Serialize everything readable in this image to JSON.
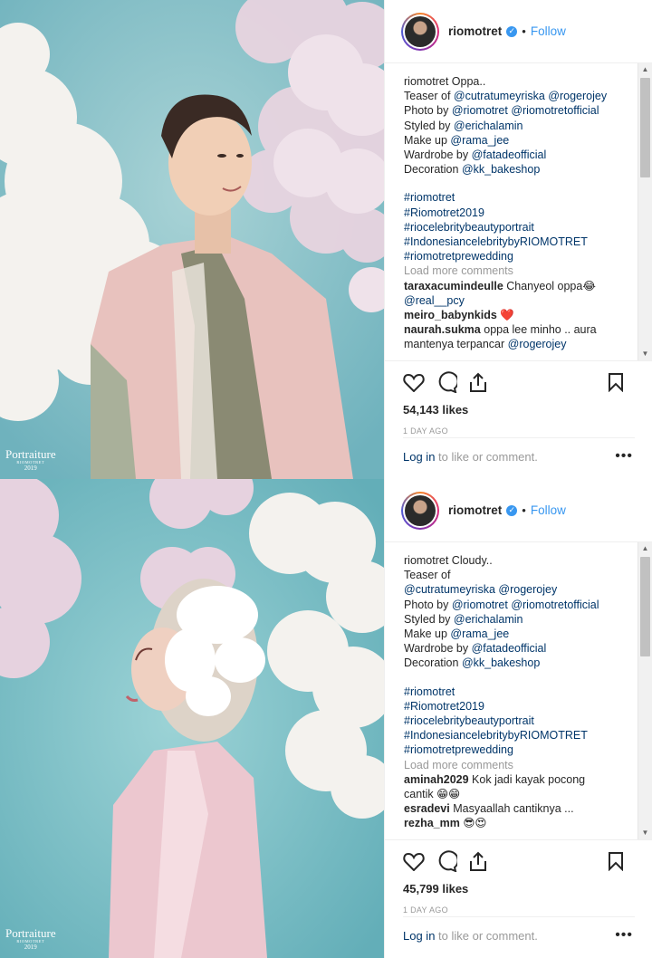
{
  "posts": [
    {
      "username": "riomotret",
      "follow_label": "Follow",
      "caption_lines": [
        {
          "parts": [
            {
              "t": "riomotret ",
              "c": "plain"
            },
            {
              "t": "Oppa..",
              "c": "plain"
            }
          ]
        },
        {
          "parts": [
            {
              "t": "Teaser of ",
              "c": "plain"
            },
            {
              "t": "@cutratumeyriska",
              "c": "link"
            },
            {
              "t": " ",
              "c": "plain"
            },
            {
              "t": "@rogerojey",
              "c": "link"
            }
          ]
        },
        {
          "parts": [
            {
              "t": "Photo by ",
              "c": "plain"
            },
            {
              "t": "@riomotret",
              "c": "link"
            },
            {
              "t": " ",
              "c": "plain"
            },
            {
              "t": "@riomotretofficial",
              "c": "link"
            }
          ]
        },
        {
          "parts": [
            {
              "t": "Styled by ",
              "c": "plain"
            },
            {
              "t": "@erichalamin",
              "c": "link"
            }
          ]
        },
        {
          "parts": [
            {
              "t": "Make up ",
              "c": "plain"
            },
            {
              "t": "@rama_jee",
              "c": "link"
            }
          ]
        },
        {
          "parts": [
            {
              "t": "Wardrobe by ",
              "c": "plain"
            },
            {
              "t": "@fatadeofficial",
              "c": "link"
            }
          ]
        },
        {
          "parts": [
            {
              "t": "Decoration ",
              "c": "plain"
            },
            {
              "t": "@kk_bakeshop",
              "c": "link"
            }
          ]
        },
        {
          "gap": true
        },
        {
          "parts": [
            {
              "t": "#riomotret",
              "c": "link"
            }
          ]
        },
        {
          "parts": [
            {
              "t": "#Riomotret2019",
              "c": "link"
            }
          ]
        },
        {
          "parts": [
            {
              "t": "#riocelebritybeautyportrait",
              "c": "link"
            }
          ]
        },
        {
          "parts": [
            {
              "t": "#IndonesiancelebritybyRIOMOTRET",
              "c": "link"
            }
          ]
        },
        {
          "parts": [
            {
              "t": "#riomotretprewedding",
              "c": "link"
            }
          ]
        },
        {
          "parts": [
            {
              "t": "Load more comments",
              "c": "muted"
            }
          ]
        },
        {
          "parts": [
            {
              "t": "taraxacumindeulle",
              "c": "bold"
            },
            {
              "t": " Chanyeol oppa😂",
              "c": "plain"
            }
          ]
        },
        {
          "parts": [
            {
              "t": "@real__pcy",
              "c": "link"
            }
          ]
        },
        {
          "parts": [
            {
              "t": "meiro_babynkids",
              "c": "bold"
            },
            {
              "t": " ❤️",
              "c": "plain"
            }
          ]
        },
        {
          "parts": [
            {
              "t": "naurah.sukma",
              "c": "bold"
            },
            {
              "t": " oppa lee minho .. aura",
              "c": "plain"
            }
          ]
        },
        {
          "parts": [
            {
              "t": "mantenya terpancar ",
              "c": "plain"
            },
            {
              "t": "@rogerojey",
              "c": "link"
            }
          ]
        }
      ],
      "likes": "54,143 likes",
      "time_ago": "1 DAY AGO",
      "login_link": "Log in",
      "login_rest": " to like or comment.",
      "watermark": {
        "title": "Portraiture",
        "sub": "RIOMOTRET",
        "year": "2019"
      }
    },
    {
      "username": "riomotret",
      "follow_label": "Follow",
      "caption_lines": [
        {
          "parts": [
            {
              "t": "riomotret ",
              "c": "plain"
            },
            {
              "t": "Cloudy..",
              "c": "plain"
            }
          ]
        },
        {
          "parts": [
            {
              "t": "Teaser of",
              "c": "plain"
            }
          ]
        },
        {
          "parts": [
            {
              "t": "@cutratumeyriska",
              "c": "link"
            },
            {
              "t": " ",
              "c": "plain"
            },
            {
              "t": "@rogerojey",
              "c": "link"
            }
          ]
        },
        {
          "parts": [
            {
              "t": "Photo by ",
              "c": "plain"
            },
            {
              "t": "@riomotret",
              "c": "link"
            },
            {
              "t": " ",
              "c": "plain"
            },
            {
              "t": "@riomotretofficial",
              "c": "link"
            }
          ]
        },
        {
          "parts": [
            {
              "t": "Styled by ",
              "c": "plain"
            },
            {
              "t": "@erichalamin",
              "c": "link"
            }
          ]
        },
        {
          "parts": [
            {
              "t": "Make up ",
              "c": "plain"
            },
            {
              "t": "@rama_jee",
              "c": "link"
            }
          ]
        },
        {
          "parts": [
            {
              "t": "Wardrobe by ",
              "c": "plain"
            },
            {
              "t": "@fatadeofficial",
              "c": "link"
            }
          ]
        },
        {
          "parts": [
            {
              "t": "Decoration ",
              "c": "plain"
            },
            {
              "t": "@kk_bakeshop",
              "c": "link"
            }
          ]
        },
        {
          "gap": true
        },
        {
          "parts": [
            {
              "t": "#riomotret",
              "c": "link"
            }
          ]
        },
        {
          "parts": [
            {
              "t": "#Riomotret2019",
              "c": "link"
            }
          ]
        },
        {
          "parts": [
            {
              "t": "#riocelebritybeautyportrait",
              "c": "link"
            }
          ]
        },
        {
          "parts": [
            {
              "t": "#IndonesiancelebritybyRIOMOTRET",
              "c": "link"
            }
          ]
        },
        {
          "parts": [
            {
              "t": "#riomotretprewedding",
              "c": "link"
            }
          ]
        },
        {
          "parts": [
            {
              "t": "Load more comments",
              "c": "muted"
            }
          ]
        },
        {
          "parts": [
            {
              "t": "aminah2029",
              "c": "bold"
            },
            {
              "t": " Kok jadi kayak pocong",
              "c": "plain"
            }
          ]
        },
        {
          "parts": [
            {
              "t": "cantik 😁😁",
              "c": "plain"
            }
          ]
        },
        {
          "parts": [
            {
              "t": "esradevi",
              "c": "bold"
            },
            {
              "t": " Masyaallah cantiknya ...",
              "c": "plain"
            }
          ]
        },
        {
          "parts": [
            {
              "t": "rezha_mm",
              "c": "bold"
            },
            {
              "t": " 😎😍",
              "c": "plain"
            }
          ]
        }
      ],
      "likes": "45,799 likes",
      "time_ago": "1 DAY AGO",
      "login_link": "Log in",
      "login_rest": " to like or comment.",
      "watermark": {
        "title": "Portraiture",
        "sub": "RIOMOTRET",
        "year": "2019"
      }
    }
  ],
  "colors": {
    "link": "#003569",
    "follow": "#3897f0",
    "muted": "#999999",
    "sky": "#8fc7cc"
  }
}
